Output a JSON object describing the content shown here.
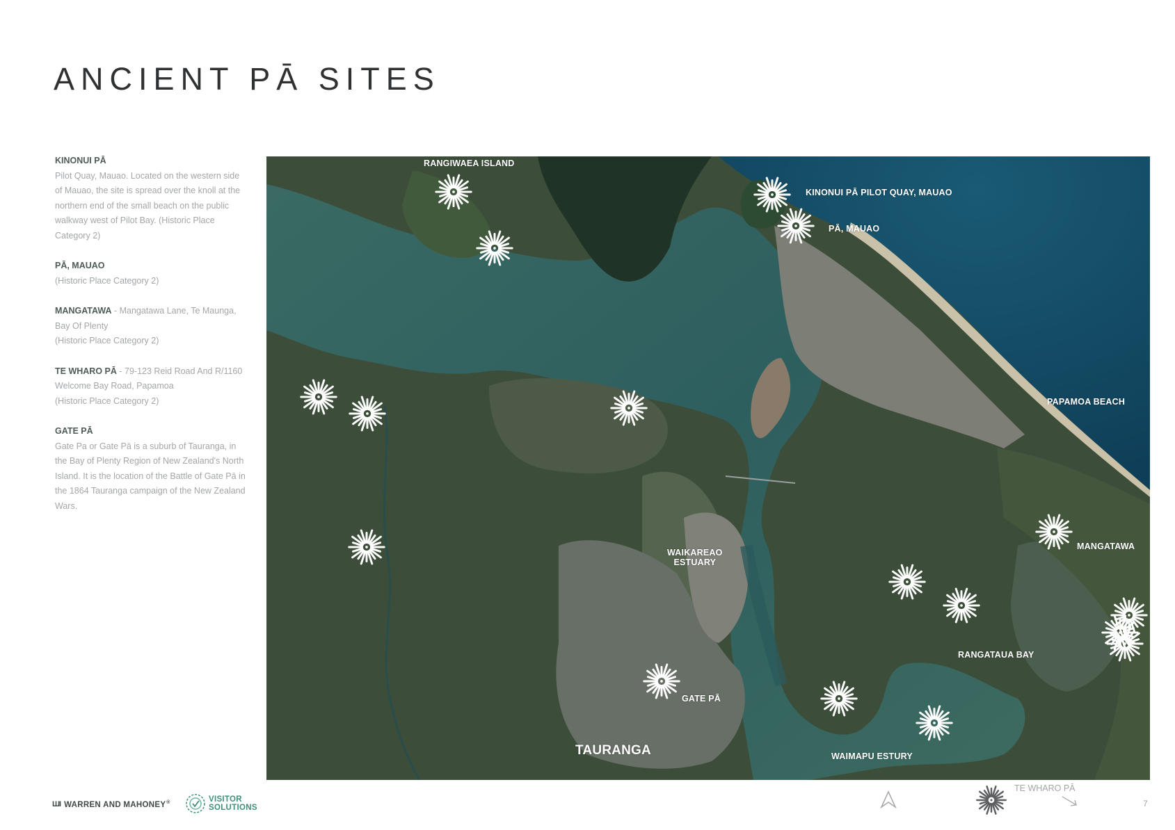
{
  "page": {
    "title": "ANCIENT PĀ SITES",
    "number": "7"
  },
  "sites": [
    {
      "name": "KINONUI PĀ",
      "inline": "",
      "desc": "Pilot Quay, Mauao. Located on the western side of Mauao, the site is spread over the knoll at the northern end of the small beach on the public walkway west of Pilot Bay. (Historic Place Category 2)"
    },
    {
      "name": "PĀ, MAUAO",
      "inline": "",
      "desc": "(Historic Place Category 2)"
    },
    {
      "name": "MANGATAWA",
      "inline": " - Mangatawa Lane, Te Maunga, Bay Of Plenty",
      "desc": "(Historic Place Category 2)"
    },
    {
      "name": "TE WHARO PĀ",
      "inline": " - 79-123 Reid Road And R/1160 Welcome Bay Road, Papamoa",
      "desc": "(Historic Place Category 2)"
    },
    {
      "name": "GATE PĀ",
      "inline": "",
      "desc": "Gate Pa or Gate Pā is a suburb of Tauranga, in the Bay of Plenty Region of New Zealand's North Island. It is the location of the Battle of Gate Pā in the 1864 Tauranga campaign of the New Zealand Wars."
    }
  ],
  "map": {
    "labels": {
      "rangiwaea": "RANGIWAEA ISLAND",
      "kinonui": "KINONUI PĀ PILOT QUAY, MAUAO",
      "pa_mauao": "PĀ, MAUAO",
      "papamoa": "PAPAMOA BEACH",
      "mangatawa": "MANGATAWA",
      "waikareao_1": "WAIKAREAO",
      "waikareao_2": "ESTUARY",
      "rangataua": "RANGATAUA BAY",
      "gate_pa": "GATE PĀ",
      "tauranga": "TAURANGA",
      "waimapu": "WAIMAPU ESTURY"
    }
  },
  "legend": {
    "label": "TE WHARO PĀ",
    "marker_icon": "pa-site-starburst-icon",
    "north_icon": "north-arrow-icon"
  },
  "logos": {
    "warren": "WARREN AND MAHONEY",
    "warren_mark": "ШI",
    "warren_reg": "®",
    "visitor_line1": "VISITOR",
    "visitor_line2": "SOLUTIONS"
  },
  "colors": {
    "sea": "#14465e",
    "harbour": "#2c5a5c",
    "land": "#384a38",
    "urban": "#6f7a72",
    "marker": "#ffffff",
    "legend_marker": "#5b5f61",
    "title": "#2f3133",
    "body_text": "#a3a6a8",
    "heading_text": "#4e5b57",
    "brand_green": "#3f8f7a"
  }
}
